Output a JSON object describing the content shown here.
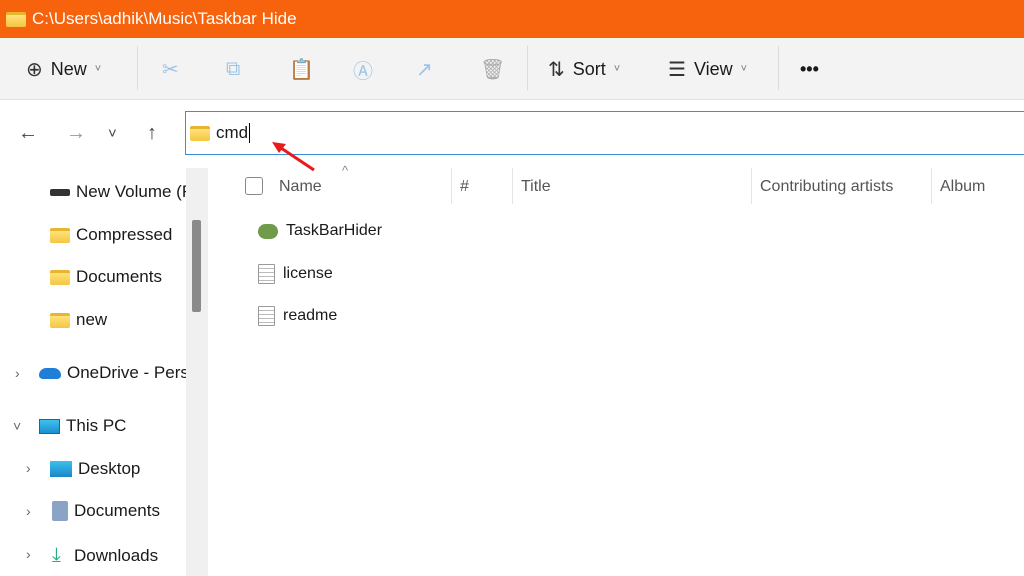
{
  "window": {
    "title": "C:\\Users\\adhik\\Music\\Taskbar Hide",
    "accent": "#f7630c"
  },
  "toolbar": {
    "new_label": "New",
    "sort_label": "Sort",
    "view_label": "View",
    "more_label": "•••"
  },
  "address": {
    "value": "cmd"
  },
  "sidebar": {
    "items": [
      {
        "label": "New Volume (F",
        "icon": "drive-icon"
      },
      {
        "label": "Compressed",
        "icon": "folder-icon"
      },
      {
        "label": "Documents",
        "icon": "folder-icon"
      },
      {
        "label": "new",
        "icon": "folder-icon"
      },
      {
        "label": "OneDrive - Personal",
        "icon": "cloud-icon"
      },
      {
        "label": "This PC",
        "icon": "monitor-icon"
      },
      {
        "label": "Desktop",
        "icon": "desktop-icon"
      },
      {
        "label": "Documents",
        "icon": "documents-icon"
      },
      {
        "label": "Downloads",
        "icon": "download-icon"
      }
    ]
  },
  "columns": [
    "Name",
    "#",
    "Title",
    "Contributing artists",
    "Album"
  ],
  "files": [
    {
      "name": "TaskBarHider",
      "icon": "frog-app-icon"
    },
    {
      "name": "license",
      "icon": "text-file-icon"
    },
    {
      "name": "readme",
      "icon": "text-file-icon"
    }
  ]
}
